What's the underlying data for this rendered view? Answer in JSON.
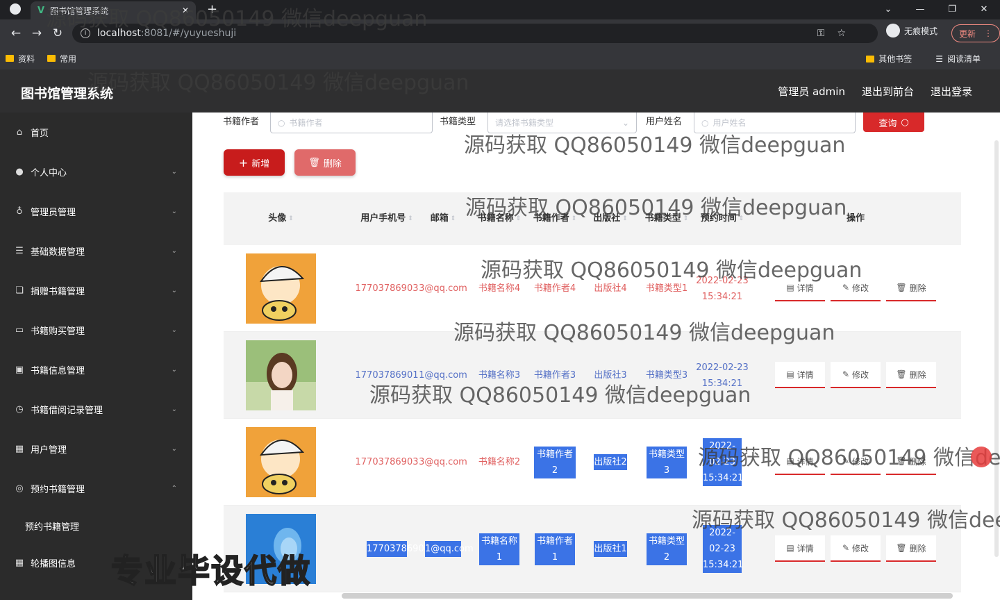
{
  "browser": {
    "tab_title": "图书馆管理系统",
    "url_host": "localhost",
    "url_path": ":8081/#/yuyueshuji",
    "incognito_label": "无痕模式",
    "update_label": "更新",
    "bookmarks": [
      "资料",
      "常用"
    ],
    "bookmarks_right": [
      "其他书签",
      "阅读清单"
    ]
  },
  "header": {
    "title": "图书馆管理系统",
    "links": [
      "管理员 admin",
      "退出到前台",
      "退出登录"
    ]
  },
  "sidebar": {
    "items": [
      {
        "label": "首页",
        "icon": "home-icon"
      },
      {
        "label": "个人中心",
        "icon": "user-icon"
      },
      {
        "label": "管理员管理",
        "icon": "mic-icon"
      },
      {
        "label": "基础数据管理",
        "icon": "sliders-icon"
      },
      {
        "label": "捐赠书籍管理",
        "icon": "copy-icon"
      },
      {
        "label": "书籍购买管理",
        "icon": "card-icon"
      },
      {
        "label": "书籍信息管理",
        "icon": "box-icon"
      },
      {
        "label": "书籍借阅记录管理",
        "icon": "clock-icon"
      },
      {
        "label": "用户管理",
        "icon": "grid-icon"
      },
      {
        "label": "预约书籍管理",
        "icon": "compass-icon"
      }
    ],
    "sub_item": "预约书籍管理",
    "last_item": "轮播图信息"
  },
  "search": {
    "author_label": "书籍作者",
    "author_placeholder": "书籍作者",
    "type_label": "书籍类型",
    "type_placeholder": "请选择书籍类型",
    "user_label": "用户姓名",
    "user_placeholder": "用户姓名",
    "query_button": "查询"
  },
  "actions": {
    "add": "新增",
    "delete": "删除"
  },
  "table": {
    "headers": [
      "头像",
      "用户手机号",
      "邮箱",
      "书籍名称",
      "书籍作者",
      "出版社",
      "书籍类型",
      "预约时间",
      "操作"
    ],
    "op_labels": [
      "详情",
      "修改",
      "删除"
    ],
    "rows": [
      {
        "phone": "17703786903",
        "email": "3@qq.com",
        "name": "书籍名称4",
        "author": "书籍作者4",
        "press": "出版社4",
        "type": "书籍类型1",
        "time": "2022-02-23 15:34:21"
      },
      {
        "phone": "17703786901",
        "email": "1@qq.com",
        "name": "书籍名称3",
        "author": "书籍作者3",
        "press": "出版社3",
        "type": "书籍类型3",
        "time": "2022-02-23 15:34:21"
      },
      {
        "phone": "17703786903",
        "email": "3@qq.com",
        "name": "书籍名称2",
        "author": "书籍作者2",
        "press": "出版社2",
        "type": "书籍类型3",
        "time": "2022-02-23 15:34:21"
      },
      {
        "phone": "17703786901",
        "email": "1@qq.com",
        "name": "书籍名称1",
        "author": "书籍作者1",
        "press": "出版社1",
        "type": "书籍类型2",
        "time": "2022-02-23 15:34:21"
      }
    ]
  },
  "watermark": "源码获取 QQ86050149 微信deepguan",
  "promo": "专业毕设代做",
  "colors": {
    "accent": "#d8292a",
    "sidebar": "#2b2b2b",
    "header": "#2f2f30",
    "highlight": "#3b73e6"
  }
}
